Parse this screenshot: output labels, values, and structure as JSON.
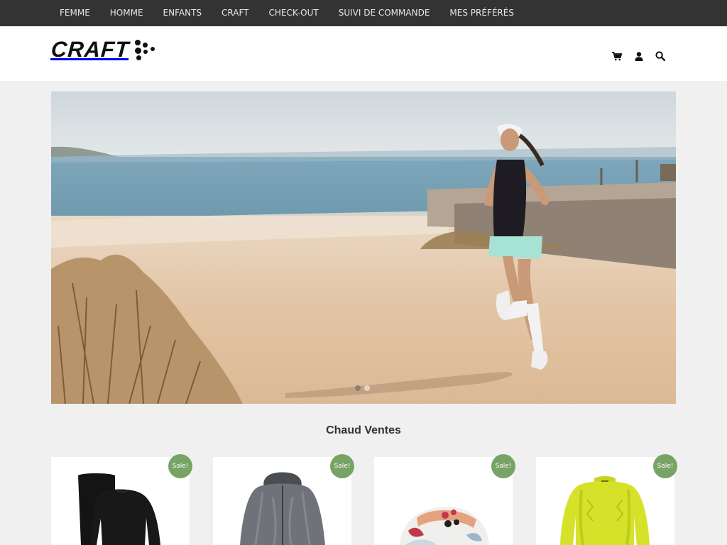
{
  "top_nav": {
    "items": [
      {
        "label": "FEMME"
      },
      {
        "label": "HOMME"
      },
      {
        "label": "ENFANTS"
      },
      {
        "label": "CRAFT"
      },
      {
        "label": "CHECK-OUT"
      },
      {
        "label": "SUIVI DE COMMANDE"
      },
      {
        "label": "MES PRÉFÉRÉS"
      }
    ]
  },
  "header": {
    "logo_text": "CRAFT",
    "icons": [
      "cart-icon",
      "user-icon",
      "search-icon"
    ]
  },
  "hero": {
    "slide_count": 2,
    "active_slide": 1
  },
  "section": {
    "title": "Chaud Ventes"
  },
  "products": [
    {
      "badge": "Sale!",
      "image": "black-base-layer-set"
    },
    {
      "badge": "Sale!",
      "image": "grey-rain-jacket"
    },
    {
      "badge": "Sale!",
      "image": "floral-running-cap"
    },
    {
      "badge": "Sale!",
      "image": "yellow-long-sleeve-top"
    }
  ],
  "colors": {
    "topbar_bg": "#333333",
    "header_bg": "#ffffff",
    "page_bg": "#f0f0f0",
    "sale_badge": "#77a464"
  }
}
